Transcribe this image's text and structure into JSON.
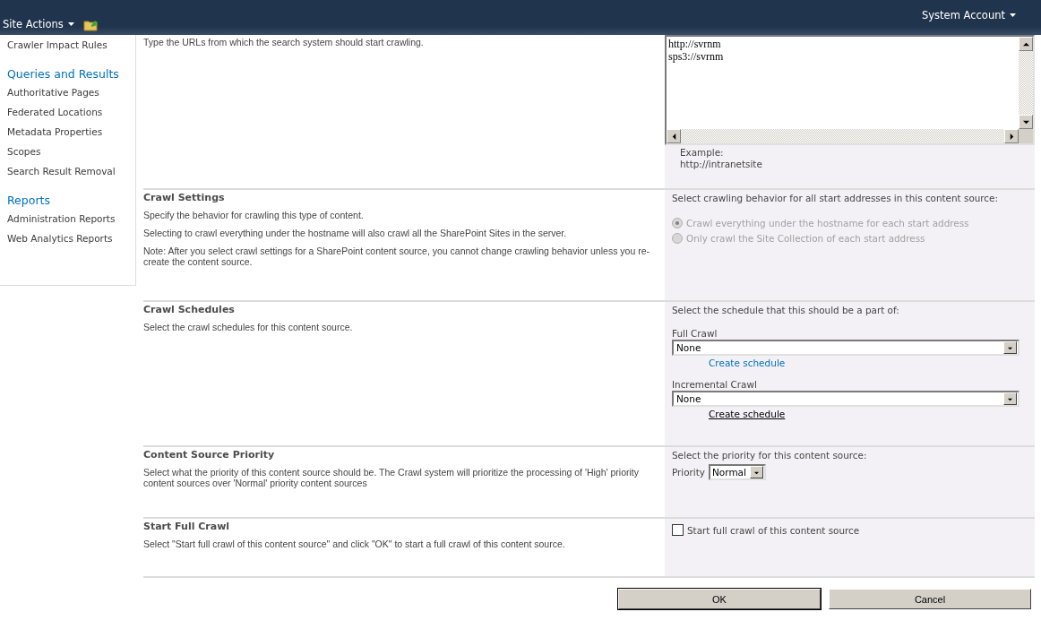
{
  "top_bar": {
    "site_actions": "Site Actions",
    "account": "System Account"
  },
  "sidebar": {
    "groups": [
      {
        "items": [
          "Crawler Impact Rules"
        ]
      },
      {
        "heading": "Queries and Results",
        "items": [
          "Authoritative Pages",
          "Federated Locations",
          "Metadata Properties",
          "Scopes",
          "Search Result Removal"
        ]
      },
      {
        "heading": "Reports",
        "items": [
          "Administration Reports",
          "Web Analytics Reports"
        ]
      }
    ]
  },
  "sections": [
    {
      "kind": "urls",
      "descriptions": [
        "Type the URLs from which the search system should start crawling."
      ],
      "lines": [
        "http://svrnm",
        "sps3://svrnm"
      ],
      "example": [
        "Example:",
        "http://intranetsite"
      ]
    },
    {
      "kind": "radios",
      "title": "Crawl Settings",
      "descriptions": [
        "Specify the behavior for crawling this type of content.",
        "Selecting to crawl everything under the hostname will also crawl all the SharePoint Sites in the server.",
        "Note: After you select crawl settings for a SharePoint content source, you cannot change crawling behavior unless you re-create the content source."
      ],
      "prompt": "Select crawling behavior for all start addresses in this content source:",
      "options": [
        {
          "label": "Crawl everything under the hostname for each start address",
          "selected": true,
          "disabled": true
        },
        {
          "label": "Only crawl the Site Collection of each start address",
          "selected": false,
          "disabled": true
        }
      ]
    },
    {
      "kind": "schedules",
      "title": "Crawl Schedules",
      "descriptions": [
        "Select the crawl schedules for this content source."
      ],
      "prompt": "Select the schedule that this should be a part of:",
      "schedules": [
        {
          "label": "Full Crawl",
          "value": "None",
          "link": "Create schedule",
          "hovered": false
        },
        {
          "label": "Incremental Crawl",
          "value": "None",
          "link": "Create schedule",
          "hovered": true
        }
      ]
    },
    {
      "kind": "priority",
      "title": "Content Source Priority",
      "descriptions": [
        "Select what the priority of this content source should be. The Crawl system will prioritize the processing of 'High' priority content sources over 'Normal' priority content sources"
      ],
      "prompt": "Select the priority for this content source:",
      "label": "Priority",
      "value": "Normal"
    },
    {
      "kind": "checkbox",
      "title": "Start Full Crawl",
      "descriptions": [
        "Select \"Start full crawl of this content source\" and click \"OK\" to start a full crawl of this content source."
      ],
      "label": "Start full crawl of this content source",
      "checked": false
    }
  ],
  "buttons": [
    {
      "label": "OK",
      "default": true
    },
    {
      "label": "Cancel",
      "default": false
    }
  ]
}
